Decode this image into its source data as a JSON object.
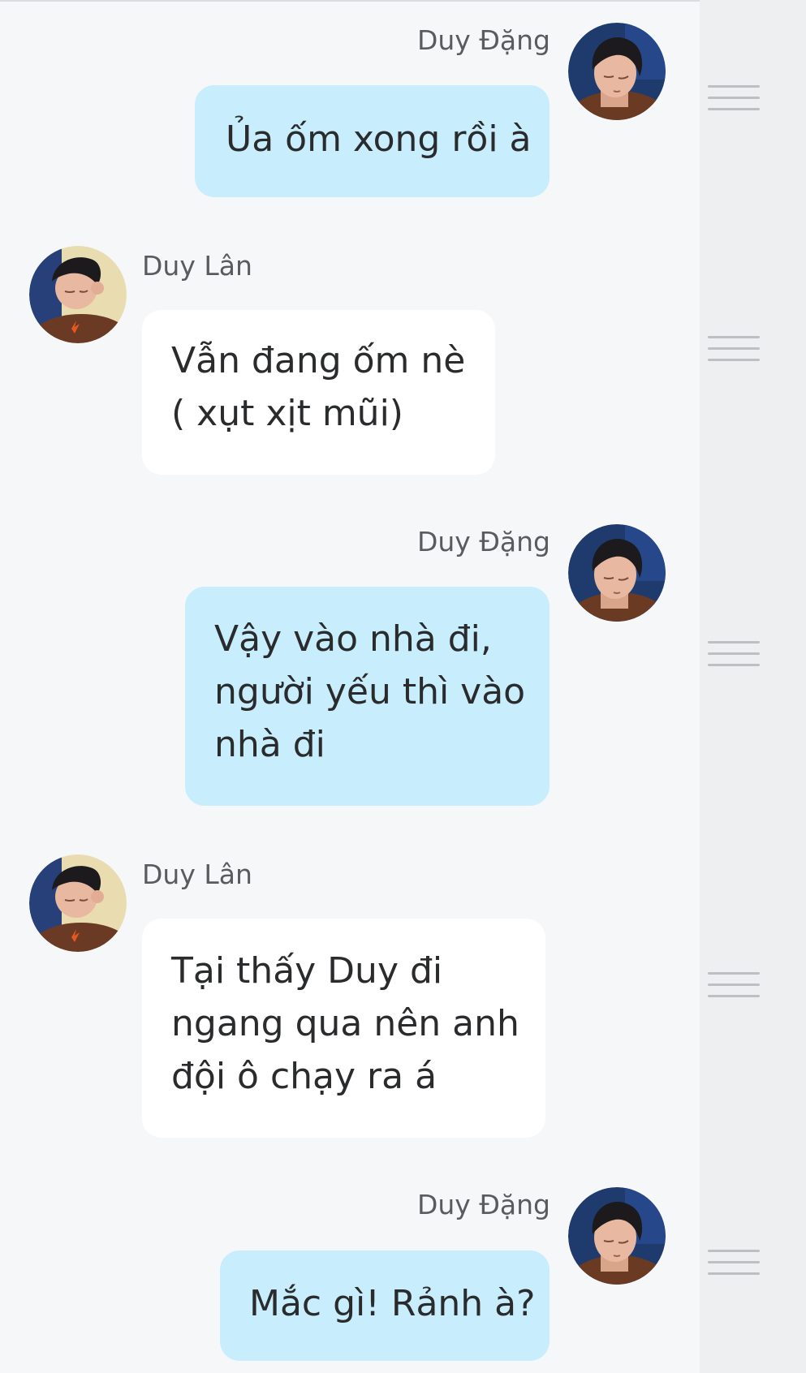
{
  "participants": {
    "me": {
      "name": "Duy Đặng",
      "avatar_icon": "avatar-duy-dang-icon"
    },
    "other": {
      "name": "Duy Lân",
      "avatar_icon": "avatar-duy-lan-icon"
    }
  },
  "colors": {
    "background": "#f5f7f9",
    "side_panel": "#eeeff1",
    "outgoing_bubble": "#c8edfc",
    "incoming_bubble": "#ffffff",
    "sender_text": "#595b5e",
    "message_text": "#2a2b2d",
    "handle": "#bdbfc2"
  },
  "messages": [
    {
      "sender": "Duy Đặng",
      "direction": "outgoing",
      "lines": [
        "Ủa ốm xong rồi à"
      ]
    },
    {
      "sender": "Duy Lân",
      "direction": "incoming",
      "lines": [
        "Vẫn đang ốm nè",
        "( xụt xịt mũi)"
      ]
    },
    {
      "sender": "Duy Đặng",
      "direction": "outgoing",
      "lines": [
        "Vậy vào nhà đi,",
        "người yếu thì vào",
        "nhà đi"
      ]
    },
    {
      "sender": "Duy Lân",
      "direction": "incoming",
      "lines": [
        "Tại thấy Duy đi",
        "ngang qua nên anh",
        "đội ô chạy ra á"
      ]
    },
    {
      "sender": "Duy Đặng",
      "direction": "outgoing",
      "lines": [
        "Mắc gì! Rảnh à?"
      ]
    }
  ],
  "reorder_handle_icon": "drag-handle-icon"
}
